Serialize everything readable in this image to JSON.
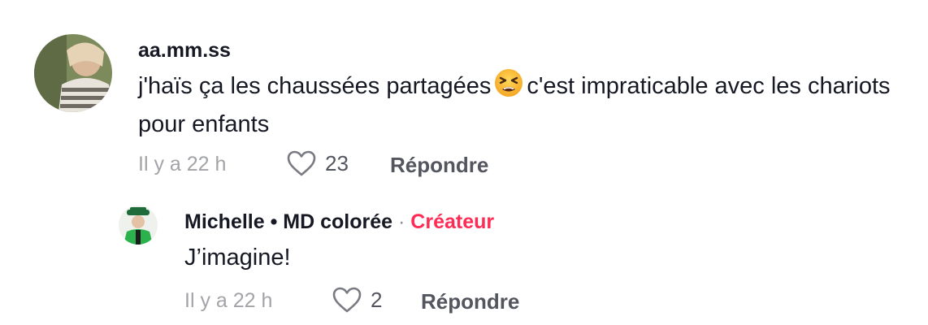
{
  "comments": [
    {
      "username": "aa.mm.ss",
      "text_before": "j'haïs ça les chaussées partagées",
      "emoji": "tired-face",
      "text_after": "c'est impraticable avec les chariots pour enfants",
      "time": "Il y a 22 h",
      "likes": "23",
      "reply_label": "Répondre"
    }
  ],
  "replies": [
    {
      "username": "Michelle • MD colorée",
      "separator": "·",
      "badge": "Créateur",
      "text": "J’imagine!",
      "time": "Il y a 22 h",
      "likes": "2",
      "reply_label": "Répondre"
    }
  ],
  "colors": {
    "creator_badge": "#fe2c55",
    "meta_text": "#a3a4a8",
    "action_text": "#54565f"
  }
}
